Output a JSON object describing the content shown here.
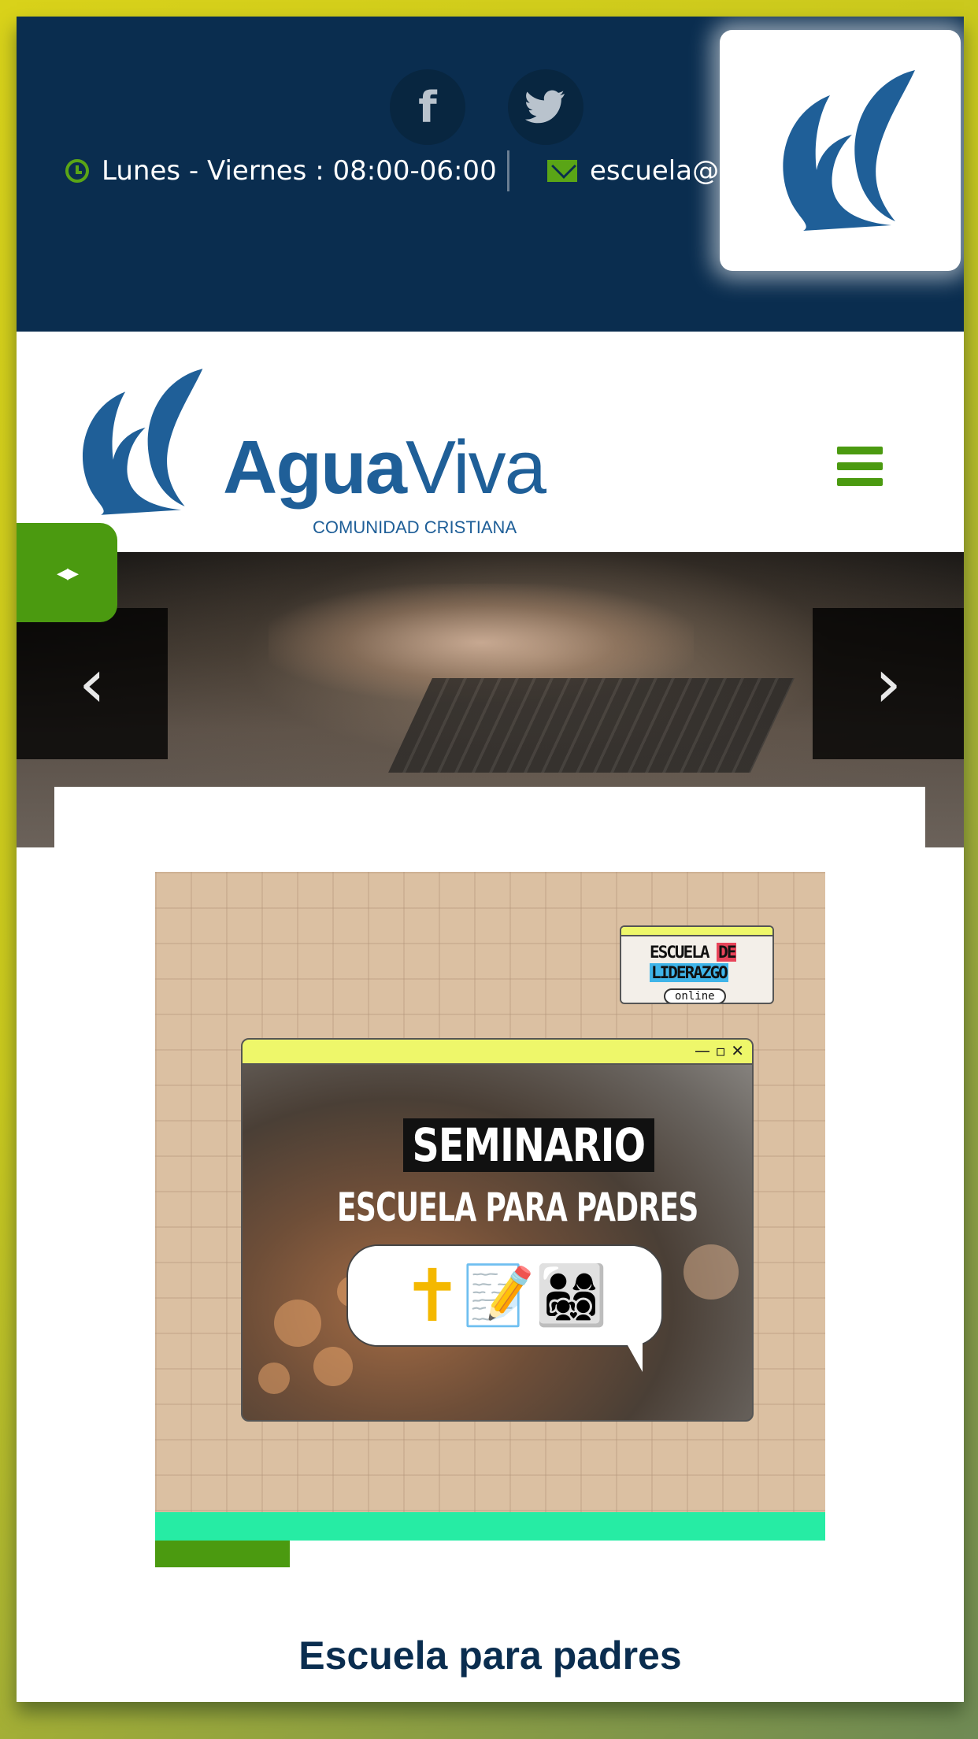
{
  "topbar": {
    "social": [
      {
        "name": "facebook",
        "glyph": "f"
      },
      {
        "name": "twitter",
        "glyph": "🐦"
      }
    ],
    "hours": "Lunes - Viernes : 08:00-06:00",
    "email": "escuela@c"
  },
  "header": {
    "brand_bold": "Agua",
    "brand_light": "Viva",
    "brand_sub": "COMUNIDAD CRISTIANA"
  },
  "slider": {
    "prev_glyph": "‹",
    "next_glyph": "›",
    "toggle_glyph": "◂▸"
  },
  "poster": {
    "badge_line1": "ESCUELA",
    "badge_de": "DE",
    "badge_line2": "LIDERAZGO",
    "badge_line3": "online",
    "window_controls": "— ▫ ✕",
    "title": "SEMINARIO",
    "subtitle": "ESCUELA PARA PADRES",
    "emoji_cross": "✝",
    "emoji_rest": "📝👨‍👩‍👧‍👦"
  },
  "post": {
    "title": "Escuela para padres"
  },
  "colors": {
    "navy": "#0a2d4f",
    "brand_blue": "#1f5f98",
    "accent_green": "#4b9a10",
    "mint": "#26eca4",
    "poster_bg": "#dbc0a2",
    "window_yellow": "#eef76a"
  }
}
